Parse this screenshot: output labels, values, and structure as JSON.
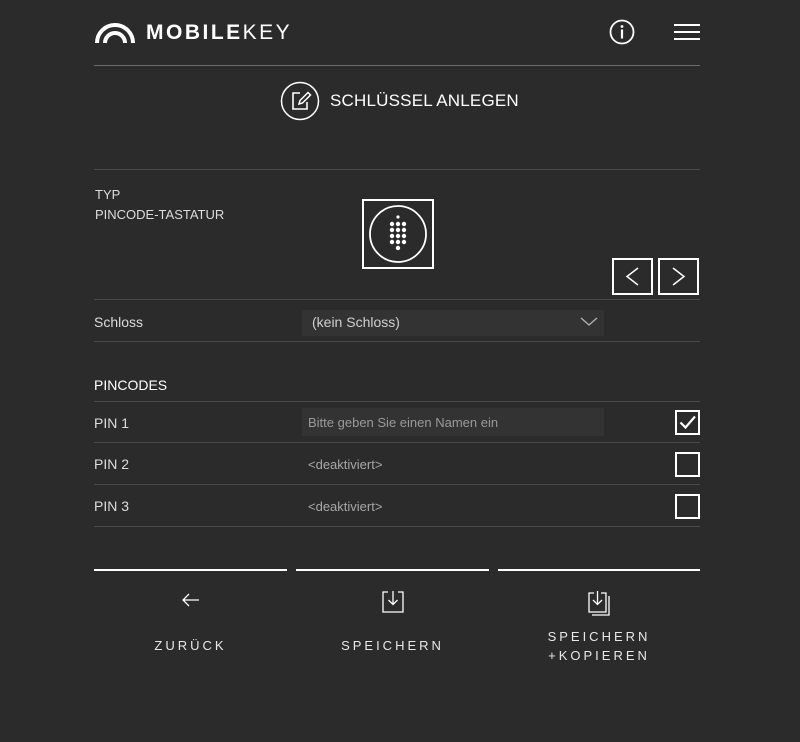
{
  "header": {
    "logo_text_bold": "MOBILE",
    "logo_text_light": "KEY",
    "info_icon": "info-icon",
    "menu_icon": "hamburger-menu-icon"
  },
  "title": {
    "icon": "edit-icon",
    "label": "SCHLÜSSEL ANLEGEN"
  },
  "type": {
    "label": "TYP",
    "value": "PINCODE-TASTATUR",
    "image_icon": "keypad-icon",
    "prev_icon": "chevron-left-icon",
    "next_icon": "chevron-right-icon"
  },
  "lock": {
    "label": "Schloss",
    "selected": "(kein Schloss)",
    "dropdown_icon": "chevron-down-icon"
  },
  "pincodes": {
    "title": "PINCODES",
    "rows": [
      {
        "label": "PIN 1",
        "placeholder": "Bitte geben Sie einen Namen ein",
        "checked": true
      },
      {
        "label": "PIN 2",
        "value": "<deaktiviert>",
        "checked": false
      },
      {
        "label": "PIN 3",
        "value": "<deaktiviert>",
        "checked": false
      }
    ]
  },
  "actions": {
    "back_label": "ZURÜCK",
    "save_label": "SPEICHERN",
    "save_copy_line1": "SPEICHERN",
    "save_copy_line2": "+KOPIEREN"
  },
  "colors": {
    "background": "#2b2b2b",
    "foreground": "#ffffff",
    "field": "#333333",
    "divider": "#4a4a4a"
  }
}
